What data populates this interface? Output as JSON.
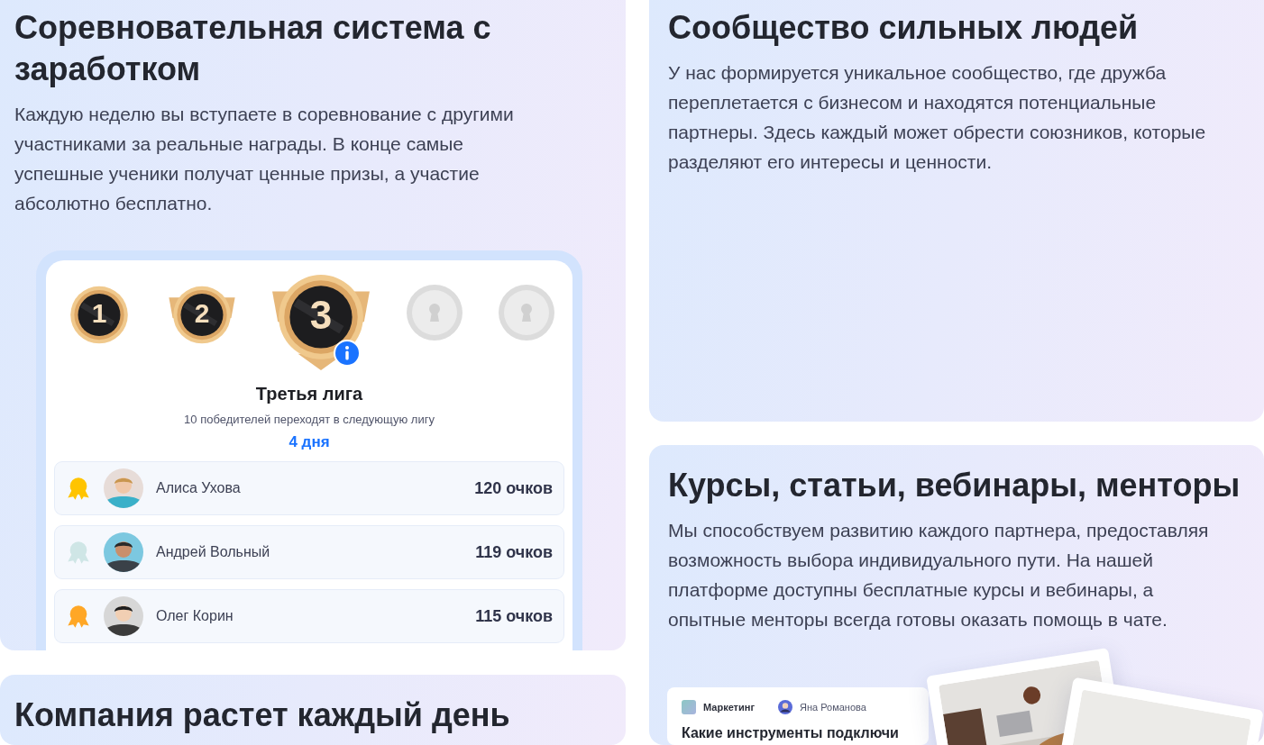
{
  "competition": {
    "title": "Соревновательная система с заработком",
    "text": "Каждую неделю вы вступаете в соревнование с другими участниками за реальные награды. В конце самые успешные ученики получат ценные призы, а участие абсолютно бесплатно.",
    "league": {
      "medals": [
        {
          "label": "1",
          "locked": false,
          "selected": false
        },
        {
          "label": "2",
          "locked": false,
          "selected": false
        },
        {
          "label": "3",
          "locked": false,
          "selected": true
        },
        {
          "locked": true,
          "selected": false
        },
        {
          "locked": true,
          "selected": false
        }
      ],
      "name": "Третья лига",
      "note": "10 победителей переходят в следующую лигу",
      "time_left": "4 дня",
      "leaders": [
        {
          "name": "Алиса Ухова",
          "points": "120 очков",
          "color": "#ffc400"
        },
        {
          "name": "Андрей Вольный",
          "points": "119 очков",
          "color": "#cfe6e6"
        },
        {
          "name": "Олег Корин",
          "points": "115 очков",
          "color": "#ffa726"
        }
      ]
    }
  },
  "growth": {
    "title": "Компания растет каждый день"
  },
  "community": {
    "title": "Сообщество сильных людей",
    "text": "У нас формируется уникальное сообщество, где дружба переплетается с бизнесом и находятся потенциальные партнеры. Здесь каждый может обрести союзников, которые разделяют его интересы и ценности."
  },
  "learning": {
    "title": "Курсы, статьи, вебинары, менторы",
    "text": "Мы способствуем развитию каждого партнера, предоставляя возможность выбора индивидуального пути. На нашей платформе доступны бесплатные курсы и вебинары, а опытные менторы всегда готовы оказать помощь в чате.",
    "article": {
      "category": "Маркетинг",
      "author": "Яна Романова",
      "title": "Какие инструменты подключи"
    }
  }
}
